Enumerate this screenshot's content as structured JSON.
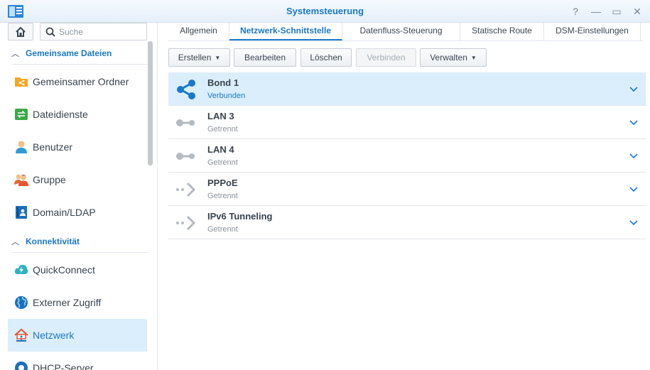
{
  "window": {
    "title": "Systemsteuerung",
    "controls": {
      "help": "?",
      "minimize": "—",
      "maximize": "▭",
      "close": "✕"
    }
  },
  "sidebar": {
    "search_placeholder": "Suche",
    "sections": [
      {
        "label": "Gemeinsame Dateien"
      },
      {
        "label": "Konnektivität"
      }
    ],
    "items": [
      {
        "label": "Gemeinsamer Ordner",
        "icon": "shared-folder-icon"
      },
      {
        "label": "Dateidienste",
        "icon": "file-services-icon"
      },
      {
        "label": "Benutzer",
        "icon": "user-icon"
      },
      {
        "label": "Gruppe",
        "icon": "group-icon"
      },
      {
        "label": "Domain/LDAP",
        "icon": "domain-ldap-icon"
      },
      {
        "label": "QuickConnect",
        "icon": "quickconnect-icon"
      },
      {
        "label": "Externer Zugriff",
        "icon": "globe-icon"
      },
      {
        "label": "Netzwerk",
        "icon": "network-house-icon",
        "active": true
      },
      {
        "label": "DHCP-Server",
        "icon": "dhcp-server-icon"
      }
    ]
  },
  "tabs": [
    {
      "label": "Allgemein"
    },
    {
      "label": "Netzwerk-Schnittstelle",
      "active": true
    },
    {
      "label": "Datenfluss-Steuerung"
    },
    {
      "label": "Statische Route"
    },
    {
      "label": "DSM-Einstellungen"
    }
  ],
  "toolbar": {
    "create": "Erstellen",
    "edit": "Bearbeiten",
    "delete": "Löschen",
    "connect": "Verbinden",
    "manage": "Verwalten"
  },
  "interfaces": [
    {
      "name": "Bond 1",
      "status": "Verbunden",
      "icon": "share-connected-icon",
      "selected": true
    },
    {
      "name": "LAN 3",
      "status": "Getrennt",
      "icon": "lan-disconnected-icon"
    },
    {
      "name": "LAN 4",
      "status": "Getrennt",
      "icon": "lan-disconnected-icon"
    },
    {
      "name": "PPPoE",
      "status": "Getrennt",
      "icon": "pppoe-arrow-icon"
    },
    {
      "name": "IPv6 Tunneling",
      "status": "Getrennt",
      "icon": "tunnel-arrow-icon"
    }
  ],
  "colors": {
    "accent": "#1a78c8",
    "selection": "#dbeefc"
  }
}
